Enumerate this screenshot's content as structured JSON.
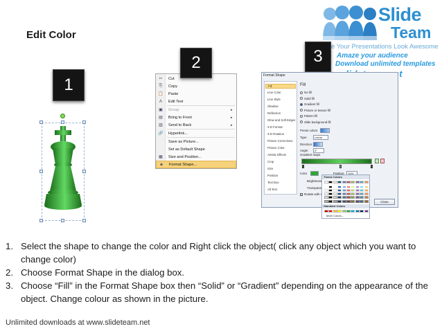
{
  "title": "Edit Color",
  "logo": {
    "brand_line1": "Slide",
    "brand_line2": "Team",
    "tagline": "Make Your Presentations Look Awesome",
    "promo_line1": "Amaze your audience",
    "promo_line2": "Download unlimited templates",
    "promo_line3": "www.slideteam.net"
  },
  "badges": [
    "1",
    "2",
    "3"
  ],
  "context_menu": {
    "items": [
      {
        "icon": "✂",
        "label": "Cut",
        "state": "normal"
      },
      {
        "icon": "⎘",
        "label": "Copy",
        "state": "normal"
      },
      {
        "icon": "📋",
        "label": "Paste",
        "state": "normal"
      },
      {
        "icon": "A",
        "label": "Edit Text",
        "state": "normal"
      },
      {
        "icon": "▣",
        "label": "Group",
        "state": "disabled",
        "arrow": "▸"
      },
      {
        "icon": "▤",
        "label": "Bring to Front",
        "state": "normal",
        "arrow": "▸"
      },
      {
        "icon": "▥",
        "label": "Send to Back",
        "state": "normal",
        "arrow": "▸"
      },
      {
        "icon": "🔗",
        "label": "Hyperlink...",
        "state": "normal"
      },
      {
        "icon": "",
        "label": "Save as Picture...",
        "state": "normal"
      },
      {
        "icon": "",
        "label": "Set as Default Shape",
        "state": "normal"
      },
      {
        "icon": "▦",
        "label": "Size and Position...",
        "state": "normal"
      },
      {
        "icon": "◈",
        "label": "Format Shape...",
        "state": "highlight"
      }
    ]
  },
  "dialog": {
    "title": "Format Shape",
    "sidebar": [
      "Fill",
      "Line Color",
      "Line Style",
      "Shadow",
      "Reflection",
      "Glow and Soft Edges",
      "3-D Format",
      "3-D Rotation",
      "Picture Corrections",
      "Picture Color",
      "Artistic Effects",
      "Crop",
      "Size",
      "Position",
      "Text Box",
      "Alt Text"
    ],
    "section_heading": "Fill",
    "fill_options": [
      {
        "label": "No fill",
        "selected": false
      },
      {
        "label": "Solid fill",
        "selected": false
      },
      {
        "label": "Gradient fill",
        "selected": true
      },
      {
        "label": "Picture or texture fill",
        "selected": false
      },
      {
        "label": "Pattern fill",
        "selected": false
      },
      {
        "label": "Slide background fill",
        "selected": false
      }
    ],
    "preset_colors_label": "Preset colors:",
    "type_label": "Type:",
    "type_value": "Linear",
    "direction_label": "Direction:",
    "angle_label": "Angle:",
    "angle_value": "0°",
    "gradient_stops_label": "Gradient stops",
    "color_label": "Color",
    "position_label": "Position:",
    "position_value": "54%",
    "brightness_label": "Brightness:",
    "transparency_label": "Transparency:",
    "rotate_label": "Rotate with shape",
    "close_label": "Close"
  },
  "palette": {
    "theme_heading": "Theme Colors",
    "standard_heading": "Standard Colors",
    "more_colors": "More Colors...",
    "theme_top_row": [
      "#ffffff",
      "#000000",
      "#eeece1",
      "#1f497d",
      "#4f81bd",
      "#c0504d",
      "#9bbb59",
      "#8064a2",
      "#4bacc6",
      "#f79646"
    ],
    "standard_row": [
      "#c00000",
      "#ff0000",
      "#ffc000",
      "#ffff00",
      "#92d050",
      "#00b050",
      "#00b0f0",
      "#0070c0",
      "#002060",
      "#7030a0"
    ]
  },
  "instructions": [
    {
      "num": "1.",
      "text": "Select the shape to change the color and Right click the object( click any object which you want to change color)"
    },
    {
      "num": "2.",
      "text": "Choose Format Shape in the dialog box."
    },
    {
      "num": "3.",
      "text": "Choose “Fill” in the Format Shape box then “Solid” or “Gradient” depending on the appearance of the object. Change colour as shown in the picture."
    }
  ],
  "footer": "Unlimited downloads at www.slideteam.net",
  "colors": {
    "brand_blue": "#2c8fd1",
    "chess_green": "#2fa82f",
    "menu_highlight": "#f6d27c"
  }
}
